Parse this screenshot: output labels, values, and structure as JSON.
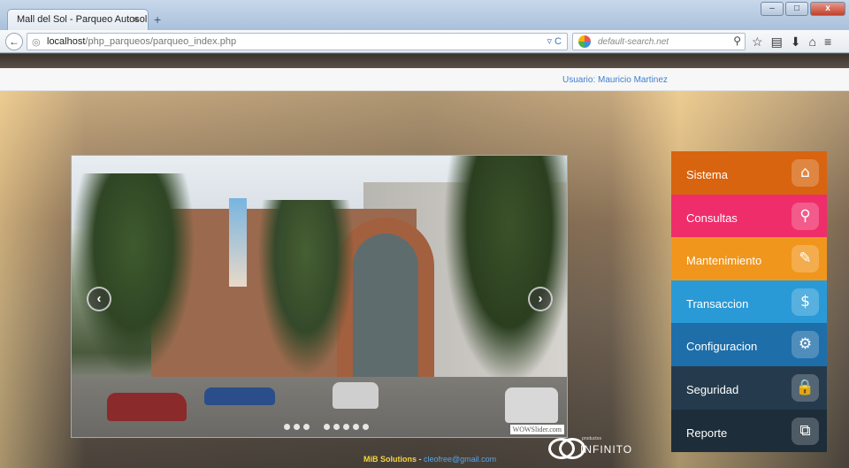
{
  "browser": {
    "tab_title": "Mall del Sol - Parqueo Autosol",
    "tab_close": "×",
    "new_tab": "+",
    "url_host": "localhost",
    "url_path": "/php_parqueos/parqueo_index.php",
    "search_placeholder": "default-search.net",
    "window_controls": {
      "minimize": "–",
      "maximize": "□",
      "close": "x"
    }
  },
  "header": {
    "user_label": "Usuario: Mauricio Martinez"
  },
  "slider": {
    "prev_label": "‹",
    "next_label": "›",
    "dots_group1": 3,
    "dots_group2": 5,
    "watermark": "WOWSlider.com"
  },
  "menu": {
    "items": [
      {
        "label": "Sistema",
        "icon": "home-icon",
        "color": "#d8640f"
      },
      {
        "label": "Consultas",
        "icon": "search-icon",
        "color": "#ef2d6a"
      },
      {
        "label": "Mantenimiento",
        "icon": "pencil-icon",
        "color": "#f0961d"
      },
      {
        "label": "Transaccion",
        "icon": "moneybag-icon",
        "color": "#2a9ad7"
      },
      {
        "label": "Configuracion",
        "icon": "gear-icon",
        "color": "#1e6ea9"
      },
      {
        "label": "Seguridad",
        "icon": "lock-icon",
        "color": "#253b4d"
      },
      {
        "label": "Reporte",
        "icon": "copy-icon",
        "color": "#1d2d39"
      }
    ]
  },
  "footer": {
    "brand": "MiB Solutions",
    "separator": " - ",
    "email": "cleofree@gmail.com",
    "logo_small": "productos",
    "logo_big": "INFINITO"
  }
}
